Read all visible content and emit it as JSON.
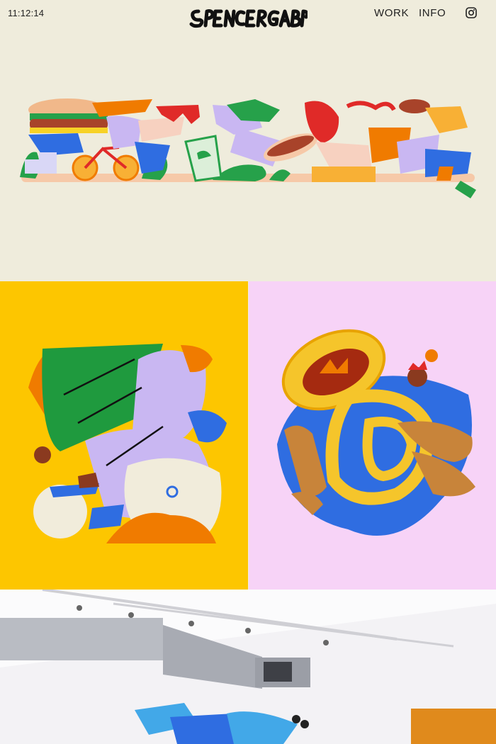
{
  "header": {
    "time": "11:12:14",
    "logo_text": "SPENCER GABOR",
    "nav": [
      {
        "label": "WORK"
      },
      {
        "label": "INFO"
      }
    ],
    "instagram_icon": "instagram-icon"
  },
  "colors": {
    "background": "#efecdc",
    "yellow_panel": "#fdc600",
    "pink_panel": "#f7d3f7",
    "text": "#222222"
  },
  "gallery": [
    {
      "id": "banner",
      "icon": "food-parade-illustration"
    },
    {
      "id": "cyclist",
      "icon": "cyclist-illustration"
    },
    {
      "id": "tuba",
      "icon": "tuba-player-illustration"
    },
    {
      "id": "mural",
      "icon": "mural-photo"
    }
  ]
}
